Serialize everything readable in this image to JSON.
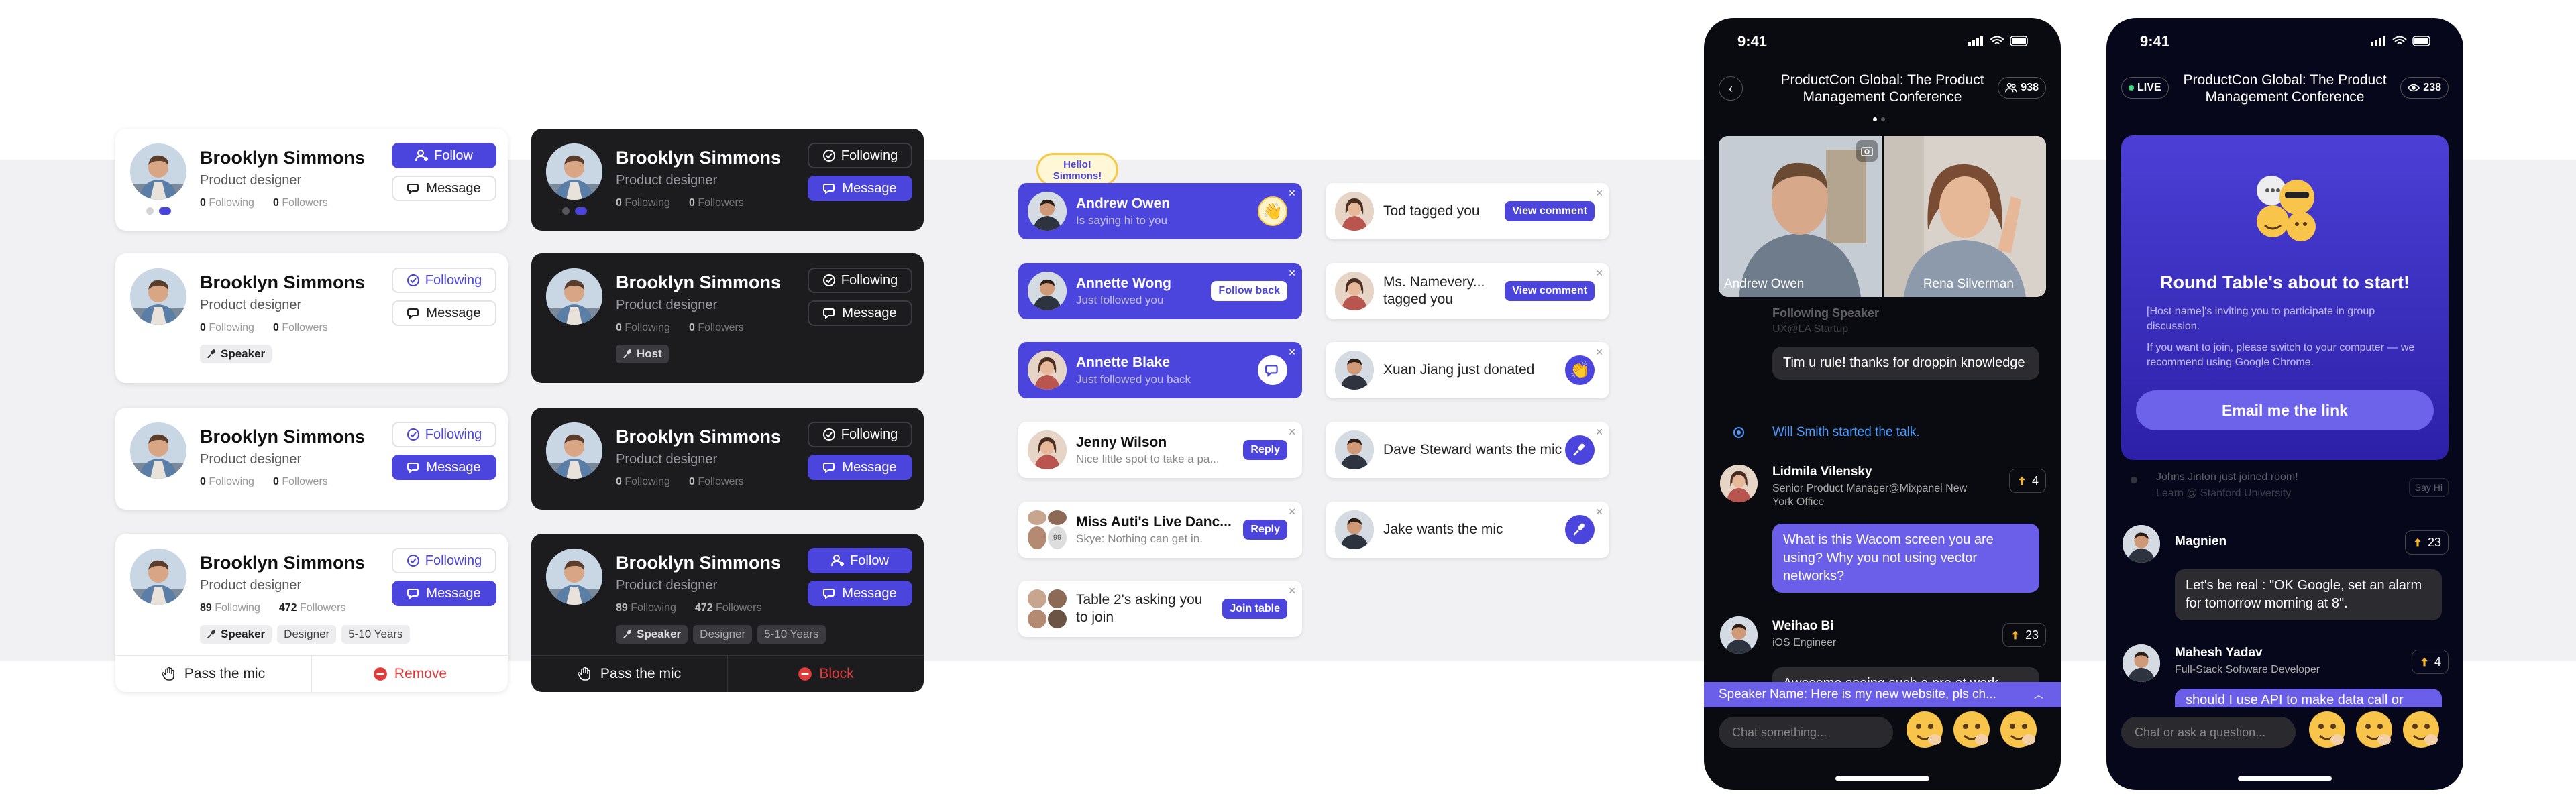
{
  "colors": {
    "primary": "#4b45dd",
    "danger": "#e23b3b",
    "dark_card": "#1c1c1f"
  },
  "profiles": {
    "name": "Brooklyn Simmons",
    "role": "Product designer",
    "following_word": "Following",
    "followers_word": "Followers",
    "zero": "0",
    "following_count": "89",
    "followers_count": "472",
    "follow": "Follow",
    "following_btn": "Following",
    "message": "Message",
    "speaker": "Speaker",
    "host": "Host",
    "designer": "Designer",
    "years": "5-10 Years",
    "pass_mic": "Pass the mic",
    "remove": "Remove",
    "block": "Block"
  },
  "notifications": {
    "hello": "Hello! Simmons!",
    "andrew": {
      "title": "Andrew Owen",
      "sub": "Is saying hi to you"
    },
    "annette_w": {
      "title": "Annette Wong",
      "sub": "Just followed you",
      "btn": "Follow back"
    },
    "annette_b": {
      "title": "Annette Blake",
      "sub": "Just followed you back"
    },
    "jenny": {
      "title": "Jenny Wilson",
      "sub": "Nice little spot to take a pa...",
      "btn": "Reply"
    },
    "miss": {
      "title": "Miss Auti's Live Danc...",
      "sub": "Skye: Nothing can get in.",
      "btn": "Reply",
      "count": "99"
    },
    "table": {
      "text": "Table 2's asking you to join",
      "btn": "Join table"
    },
    "tod": {
      "text": "Tod tagged you",
      "btn": "View comment"
    },
    "namevery": {
      "text": "Ms. Namevery... tagged you",
      "btn": "View comment"
    },
    "xuan": {
      "text": "Xuan Jiang just donated"
    },
    "dave": {
      "text": "Dave Steward wants the mic"
    },
    "jake": {
      "text": "Jake wants the mic"
    }
  },
  "phone1": {
    "time": "9:41",
    "title": "ProductCon Global: The Product Management Conference",
    "viewers": "938",
    "video_left": "Andrew Owen",
    "video_right": "Rena Silverman",
    "faded_name": "Following Speaker",
    "faded_role": "UX@LA Startup",
    "msg1": "Tim u rule! thanks for droppin knowledge",
    "system_name": "Will Smith",
    "system_text": "started the talk.",
    "user1": {
      "name": "Lidmila Vilensky",
      "role": "Senior Product Manager@Mixpanel New York Office",
      "votes": "4",
      "msg": "What is this Wacom screen you are using? Why you not using vector networks?"
    },
    "user2": {
      "name": "Weihao Bi",
      "role": "iOS Engineer",
      "votes": "23",
      "msg": "Awesome seeing such a pro at work"
    },
    "banner": "Speaker Name: Here is my new website, pls ch...",
    "chat_placeholder": "Chat something..."
  },
  "phone2": {
    "time": "9:41",
    "title": "ProductCon Global: The Product Management Conference",
    "live": "LIVE",
    "viewers": "238",
    "modal_title": "Round Table's about to start!",
    "modal_text1": "[Host name]'s inviting you to participate in group discussion.",
    "modal_text2": "If you want to join, please switch to your computer — we recommend using Google Chrome.",
    "modal_btn": "Email me the link",
    "faded_name": "Johns Jinton just joined room!",
    "faded_role": "Learn @ Stanford University",
    "faded_action": "Say Hi",
    "user1": {
      "name": "Magnien",
      "votes": "23",
      "msg": "Let's be real : \"OK Google, set an alarm for tomorrow morning at 8\"."
    },
    "user2": {
      "name": "Mahesh Yadav",
      "role": "Full-Stack Software Developer",
      "votes": "4",
      "msg": "should I use API to make data call or"
    },
    "chat_placeholder": "Chat or ask a question..."
  }
}
